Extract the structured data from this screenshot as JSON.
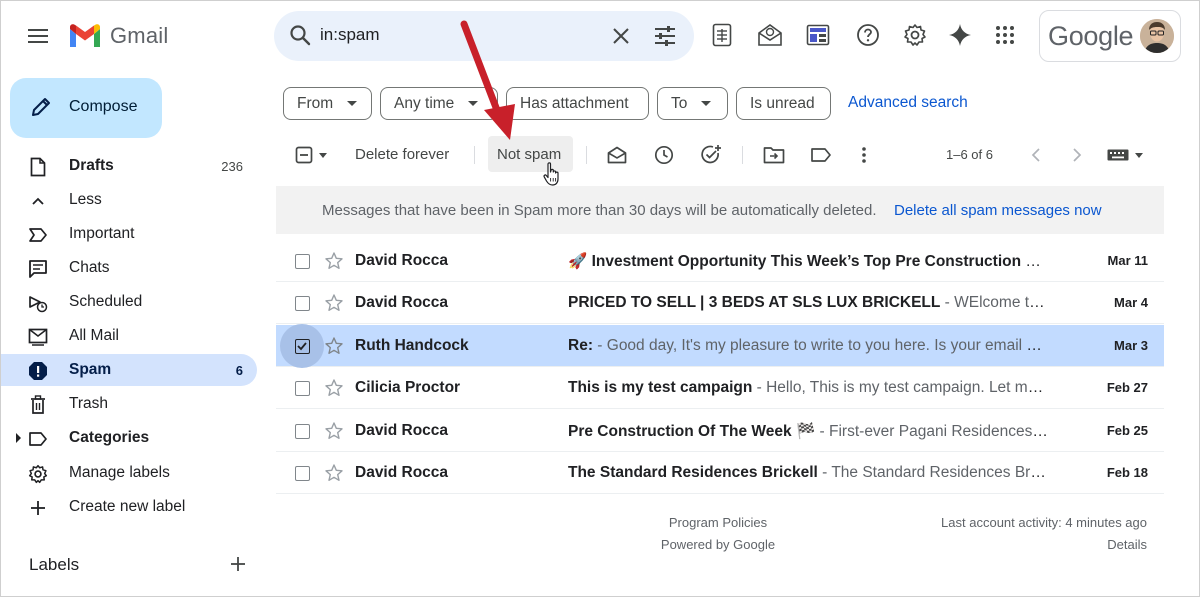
{
  "app": {
    "name": "Gmail"
  },
  "search": {
    "query": "in:spam"
  },
  "account": {
    "brand_text": "Google"
  },
  "topbar_icons": [
    "spreadsheet-icon",
    "envelope-badge-icon",
    "template-icon",
    "help-icon",
    "settings-icon",
    "gemini-icon",
    "apps-grid-icon"
  ],
  "compose": {
    "label": "Compose"
  },
  "sidebar": {
    "items": [
      {
        "label": "Drafts",
        "count": "236",
        "icon": "draft-icon",
        "bold": true
      },
      {
        "label": "Less",
        "count": "",
        "icon": "chevron-up-icon"
      },
      {
        "label": "Important",
        "count": "",
        "icon": "important-icon"
      },
      {
        "label": "Chats",
        "count": "",
        "icon": "chat-icon"
      },
      {
        "label": "Scheduled",
        "count": "",
        "icon": "scheduled-icon"
      },
      {
        "label": "All Mail",
        "count": "",
        "icon": "all-mail-icon"
      },
      {
        "label": "Spam",
        "count": "6",
        "icon": "spam-icon",
        "active": true
      },
      {
        "label": "Trash",
        "count": "",
        "icon": "trash-icon"
      },
      {
        "label": "Categories",
        "count": "",
        "icon": "label-outline-icon",
        "bold": true
      },
      {
        "label": "Manage labels",
        "count": "",
        "icon": "gear-icon"
      },
      {
        "label": "Create new label",
        "count": "",
        "icon": "plus-icon"
      }
    ],
    "labels_heading": "Labels"
  },
  "filters": {
    "chips": [
      "From",
      "Any time",
      "Has attachment",
      "To",
      "Is unread"
    ],
    "advanced_search": "Advanced search"
  },
  "toolbar": {
    "delete_forever": "Delete forever",
    "not_spam": "Not spam",
    "pager": "1–6 of 6"
  },
  "banner": {
    "text": "Messages that have been in Spam more than 30 days will be automatically deleted.",
    "link": "Delete all spam messages now"
  },
  "messages": [
    {
      "sender": "David Rocca",
      "subject": "🚀 Investment Opportunity This Week’s Top Pre Construction Pr...",
      "snippet": "",
      "date": "Mar 11",
      "selected": false
    },
    {
      "sender": "David Rocca",
      "subject": "PRICED TO SELL | 3 BEDS AT SLS LUX BRICKELL",
      "snippet": " - WElcome to the...",
      "date": "Mar 4",
      "selected": false
    },
    {
      "sender": "Ruth Handcock",
      "subject": "Re:",
      "snippet": " - Good day, It's my pleasure to write to you here. Is your email stil...",
      "date": "Mar 3",
      "selected": true
    },
    {
      "sender": "Cilicia Proctor",
      "subject": "This is my test campaign",
      "snippet": " - Hello, This is my test campaign. Let me k...",
      "date": "Feb 27",
      "selected": false
    },
    {
      "sender": "David Rocca",
      "subject": "Pre Construction Of The Week 🏁",
      "snippet": " - First-ever Pagani Residences ...",
      "date": "Feb 25",
      "selected": false
    },
    {
      "sender": "David Rocca",
      "subject": "The Standard Residences Brickell",
      "snippet": " - The Standard Residences Brick...",
      "date": "Feb 18",
      "selected": false
    }
  ],
  "footer": {
    "program_policies": "Program Policies",
    "powered_by": "Powered by Google",
    "last_activity": "Last account activity: 4 minutes ago",
    "details": "Details"
  },
  "colors": {
    "accent_blue": "#0b57d0",
    "compose_bg": "#c2e7ff",
    "active_nav_bg": "#d3e3fd",
    "selected_row_bg": "#c2dbff",
    "annotation_arrow": "#c8202a"
  }
}
